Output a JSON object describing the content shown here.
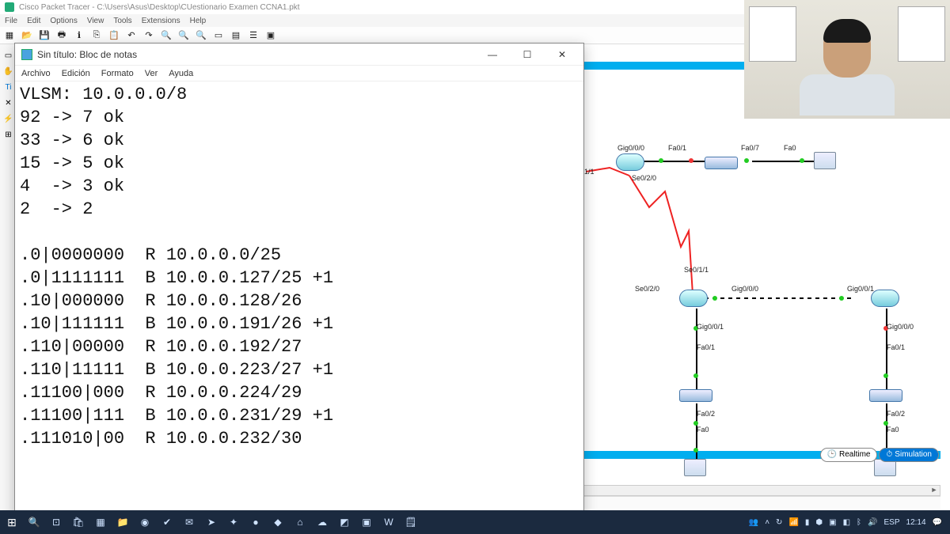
{
  "packet_tracer": {
    "title": "Cisco Packet Tracer - C:\\Users\\Asus\\Desktop\\CUestionario Examen CCNA1.pkt",
    "menu": [
      "File",
      "Edit",
      "Options",
      "View",
      "Tools",
      "Extensions",
      "Help"
    ],
    "palette_hint": "Automatically Choose Connection Type",
    "realtime_label": "Realtime",
    "simulation_label": "Simulation",
    "interface_labels": {
      "gig000_top": "Gig0/0/0",
      "fa01_top": "Fa0/1",
      "fa07": "Fa0/7",
      "fa0_top": "Fa0",
      "se020_top": "Se0/2/0",
      "se011": "Se0/1/1",
      "se020_mid": "Se0/2/0",
      "gig000_mid": "Gig0/0/0",
      "gig001_right": "Gig0/0/1",
      "gig001_left": "Gig0/0/1",
      "gig000_right": "Gig0/0/0",
      "fa01_left": "Fa0/1",
      "fa01_right": "Fa0/1",
      "fa02_left": "Fa0/2",
      "fa02_right": "Fa0/2",
      "fa0_left": "Fa0",
      "fa0_right": "Fa0",
      "oneone": "1/1"
    }
  },
  "notepad": {
    "title": "Sin título: Bloc de notas",
    "menu": [
      "Archivo",
      "Edición",
      "Formato",
      "Ver",
      "Ayuda"
    ],
    "content": "VLSM: 10.0.0.0/8\n92 -> 7 ok\n33 -> 6 ok\n15 -> 5 ok\n4  -> 3 ok\n2  -> 2\n\n.0|0000000  R 10.0.0.0/25\n.0|1111111  B 10.0.0.127/25 +1\n.10|000000  R 10.0.0.128/26\n.10|111111  B 10.0.0.191/26 +1\n.110|00000  R 10.0.0.192/27\n.110|11111  B 10.0.0.223/27 +1\n.11100|000  R 10.0.0.224/29\n.11100|111  B 10.0.0.231/29 +1\n.111010|00  R 10.0.0.232/30"
  },
  "taskbar": {
    "lang": "ESP",
    "clock": "12:14"
  }
}
